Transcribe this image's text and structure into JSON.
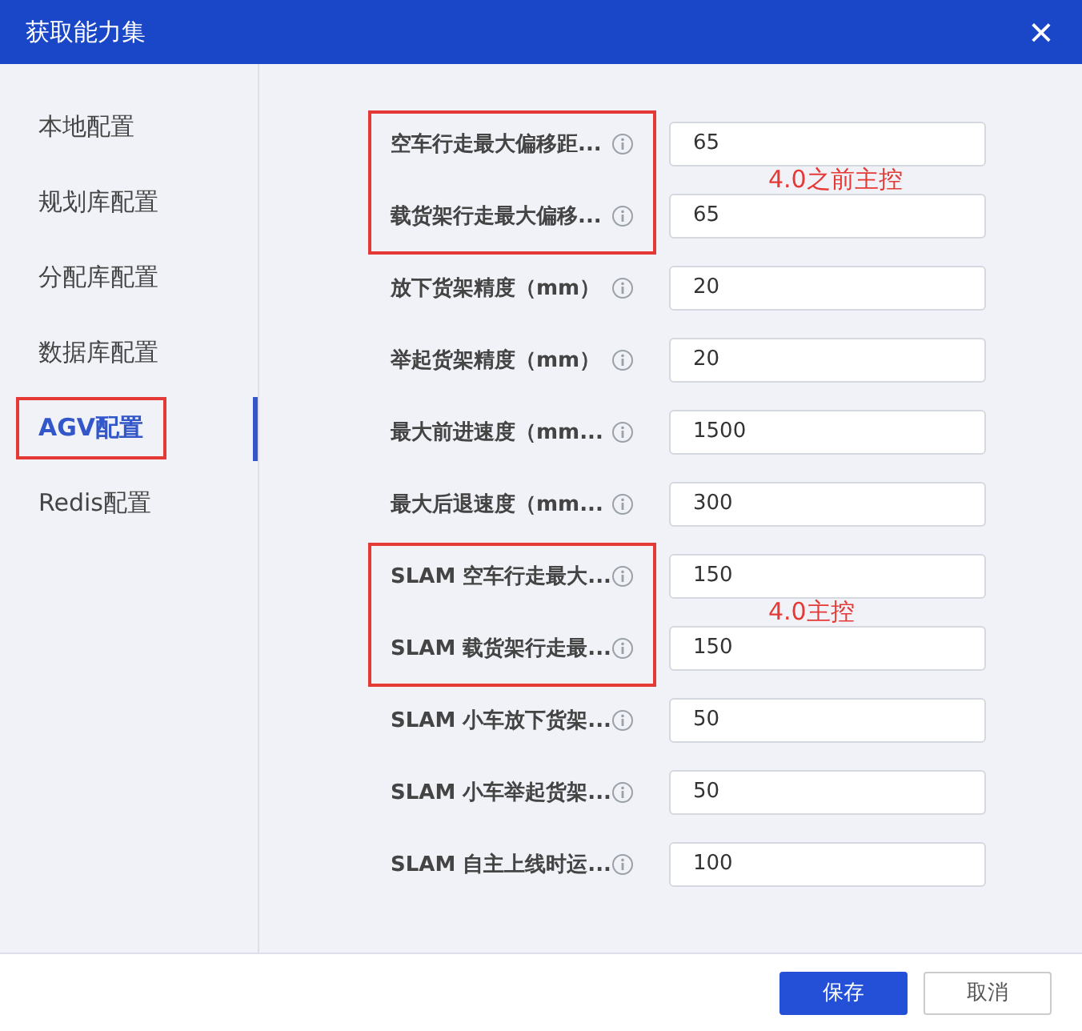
{
  "window": {
    "title": "获取能力集",
    "close": "×"
  },
  "sidebar": {
    "items": [
      {
        "label": "本地配置",
        "selected": false,
        "annotated": false
      },
      {
        "label": "规划库配置",
        "selected": false,
        "annotated": false
      },
      {
        "label": "分配库配置",
        "selected": false,
        "annotated": false
      },
      {
        "label": "数据库配置",
        "selected": false,
        "annotated": false
      },
      {
        "label": "AGV配置",
        "selected": true,
        "annotated": true
      },
      {
        "label": "Redis配置",
        "selected": false,
        "annotated": false
      }
    ]
  },
  "form": {
    "groups": [
      {
        "annotation": "4.0之前主控",
        "fields": [
          {
            "label": "空车行走最大偏移距...",
            "value": "65"
          },
          {
            "label": "载货架行走最大偏移...",
            "value": "65"
          }
        ]
      },
      {
        "fields": [
          {
            "label": "放下货架精度（mm）",
            "value": "20"
          },
          {
            "label": "举起货架精度（mm）",
            "value": "20"
          },
          {
            "label": "最大前进速度（mm...",
            "value": "1500"
          },
          {
            "label": "最大后退速度（mm...",
            "value": "300"
          }
        ]
      },
      {
        "annotation": "4.0主控",
        "fields": [
          {
            "label": "SLAM 空车行走最大...",
            "value": "150"
          },
          {
            "label": "SLAM 载货架行走最...",
            "value": "150"
          }
        ]
      },
      {
        "fields": [
          {
            "label": "SLAM 小车放下货架...",
            "value": "50"
          },
          {
            "label": "SLAM 小车举起货架...",
            "value": "50"
          },
          {
            "label": "SLAM 自主上线时运...",
            "value": "100"
          }
        ]
      }
    ]
  },
  "buttons": [
    {
      "label": "保存",
      "kind": "primary"
    },
    {
      "label": "取消",
      "kind": "secondary"
    }
  ]
}
